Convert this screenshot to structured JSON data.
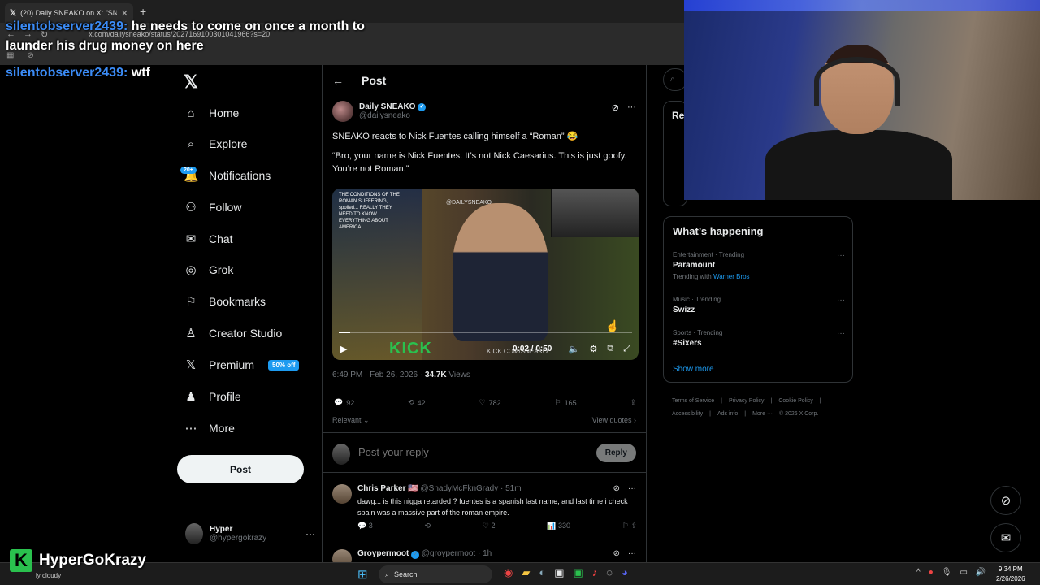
{
  "browser": {
    "tab_title": "(20) Daily SNEAKO on X: \"SNEA",
    "tab_close": "✕",
    "new_tab": "+",
    "url": "x.com/dailysneako/status/2027169100301041966?s=20"
  },
  "chat": [
    {
      "user": "silentobserver2439:",
      "message": "he needs to come on once a month to"
    },
    {
      "user": "",
      "message": "launder his drug money on here"
    },
    {
      "user": "silentobserver2439:",
      "message": "wtf"
    }
  ],
  "nav": {
    "logo": "𝕏",
    "items": [
      {
        "icon": "home-icon",
        "glyph": "⌂",
        "label": "Home"
      },
      {
        "icon": "search-icon",
        "glyph": "⌕",
        "label": "Explore"
      },
      {
        "icon": "bell-icon",
        "glyph": "♫",
        "label": "Notifications"
      },
      {
        "icon": "follow-icon",
        "glyph": "⚇",
        "label": "Follow"
      },
      {
        "icon": "mail-icon",
        "glyph": "✉",
        "label": "Chat"
      },
      {
        "icon": "grok-icon",
        "glyph": "◎",
        "label": "Grok"
      },
      {
        "icon": "bookmark-icon",
        "glyph": "⚐",
        "label": "Bookmarks"
      },
      {
        "icon": "creator-icon",
        "glyph": "♙",
        "label": "Creator Studio"
      },
      {
        "icon": "x-icon",
        "glyph": "𝕏",
        "label": "Premium"
      },
      {
        "icon": "profile-icon",
        "glyph": "♟",
        "label": "Profile"
      },
      {
        "icon": "more-icon",
        "glyph": "⋯",
        "label": "More"
      }
    ],
    "notifications_badge": "20+",
    "premium_badge": "50% off",
    "post_button": "Post",
    "account": {
      "name": "Hyper",
      "handle": "@hypergokrazy",
      "more": "···"
    }
  },
  "main": {
    "title": "Post",
    "author": {
      "name": "Daily SNEAKO",
      "handle": "@dailysneako",
      "verified": "✓"
    },
    "text": [
      "SNEAKO reacts to Nick Fuentes calling himself a “Roman” 😂",
      "“Bro, your name is Nick Fuentes. It’s not Nick Caesarius. This is just goofy. You’re not Roman.”"
    ],
    "video": {
      "watermark": "@DAILYSNEAKO",
      "overlay_text": "THE CONDITIONS OF THE ROMAN SUFFERING, spoiled... REALLY THEY NEED TO KNOW EVERYTHING ABOUT AMERICA",
      "kick_logo": "KICK",
      "kick_url": "KICK.COM/SNEAKO",
      "time": "0:02 / 0:50",
      "progress": 0.04
    },
    "meta": {
      "time": "6:49 PM · Feb 26, 2026 · ",
      "views": "34.7K",
      "views_label": " Views"
    },
    "actions": {
      "replies": "92",
      "reposts": "42",
      "likes": "782",
      "bookmarks": "165"
    },
    "relevant": "Relevant ⌄",
    "view_quotes": "View quotes ›",
    "reply_placeholder": "Post your reply",
    "reply_button": "Reply",
    "replies": [
      {
        "name": "Chris Parker 🇺🇸",
        "handle": "@ShadyMcFknGrady · 51m",
        "text": "dawg... is this nigga retarded ? fuentes is a spanish last name, and last time i check spain was a massive part of the roman empire.",
        "replies": "3",
        "reposts": "",
        "likes": "2",
        "views": "330"
      },
      {
        "name": "Groypermoot",
        "handle": "@groypermoot · 1h",
        "text": "",
        "replies": "",
        "reposts": "",
        "likes": "",
        "views": ""
      }
    ]
  },
  "right": {
    "relevant_label": "Re",
    "happening_title": "What’s happening",
    "trends": [
      {
        "category": "Entertainment · Trending",
        "name": "Paramount",
        "with_label": "Trending with ",
        "with": "Warner Bros"
      },
      {
        "category": "Music · Trending",
        "name": "Swizz",
        "with_label": "",
        "with": ""
      },
      {
        "category": "Sports · Trending",
        "name": "#Sixers",
        "with_label": "",
        "with": ""
      }
    ],
    "show_more": "Show more",
    "footer": [
      "Terms of Service",
      "|",
      "Privacy Policy",
      "|",
      "Cookie Policy",
      "|",
      "Accessibility",
      "|",
      "Ads info",
      "|",
      "More ···",
      "© 2026 X Corp."
    ]
  },
  "overlay": {
    "channel_logo": "K",
    "channel_name": "HyperGoKrazy",
    "weather": "ly cloudy"
  },
  "taskbar": {
    "search": "Search",
    "time": "9:34 PM",
    "date": "2/26/2026"
  },
  "colors": {
    "accent": "#1d9bf0",
    "kick": "#2ac14e",
    "chat_user": "#3b8bf5"
  }
}
